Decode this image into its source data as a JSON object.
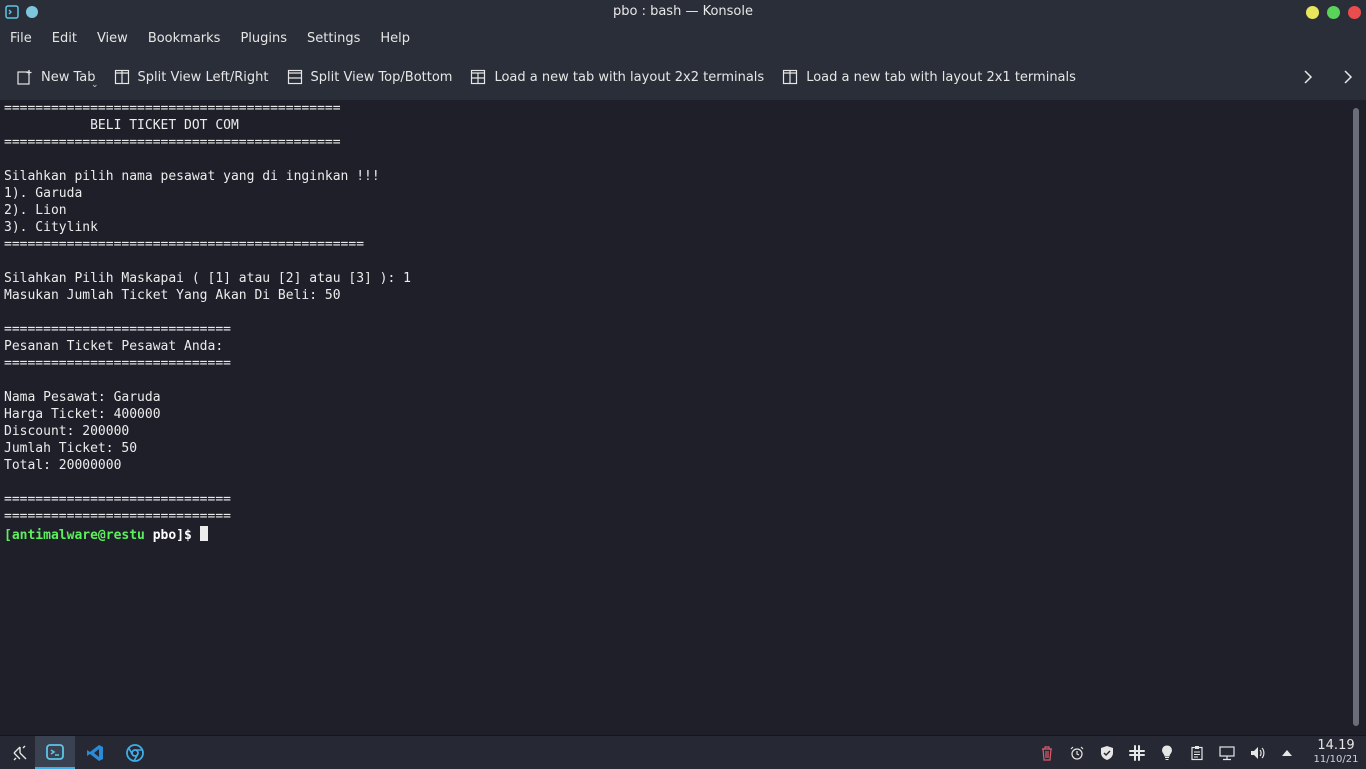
{
  "window": {
    "title": "pbo : bash — Konsole"
  },
  "menu": [
    "File",
    "Edit",
    "View",
    "Bookmarks",
    "Plugins",
    "Settings",
    "Help"
  ],
  "toolbar": {
    "new_tab": "New Tab",
    "split_lr": "Split View Left/Right",
    "split_tb": "Split View Top/Bottom",
    "layout_2x2": "Load a new tab with layout 2x2 terminals",
    "layout_2x1": "Load a new tab with layout 2x1 terminals"
  },
  "terminal": {
    "lines": [
      "===========================================",
      "           BELI TICKET DOT COM",
      "===========================================",
      "",
      "Silahkan pilih nama pesawat yang di inginkan !!!",
      "1). Garuda",
      "2). Lion",
      "3). Citylink",
      "==============================================",
      "",
      "Silahkan Pilih Maskapai ( [1] atau [2] atau [3] ): 1",
      "Masukan Jumlah Ticket Yang Akan Di Beli: 50",
      "",
      "=============================",
      "Pesanan Ticket Pesawat Anda:",
      "=============================",
      "",
      "Nama Pesawat: Garuda",
      "Harga Ticket: 400000",
      "Discount: 200000",
      "Jumlah Ticket: 50",
      "Total: 20000000",
      "",
      "=============================",
      "============================="
    ],
    "prompt_open": "[",
    "prompt_user": "antimalware@restu",
    "prompt_dir": " pbo",
    "prompt_close": "]$"
  },
  "taskbar": {
    "time": "14.19",
    "date": "11/10/21"
  },
  "colors": {
    "accent": "#3daee9",
    "prompt_green": "#5cf05c",
    "terminal_bg": "#1e1f29"
  }
}
